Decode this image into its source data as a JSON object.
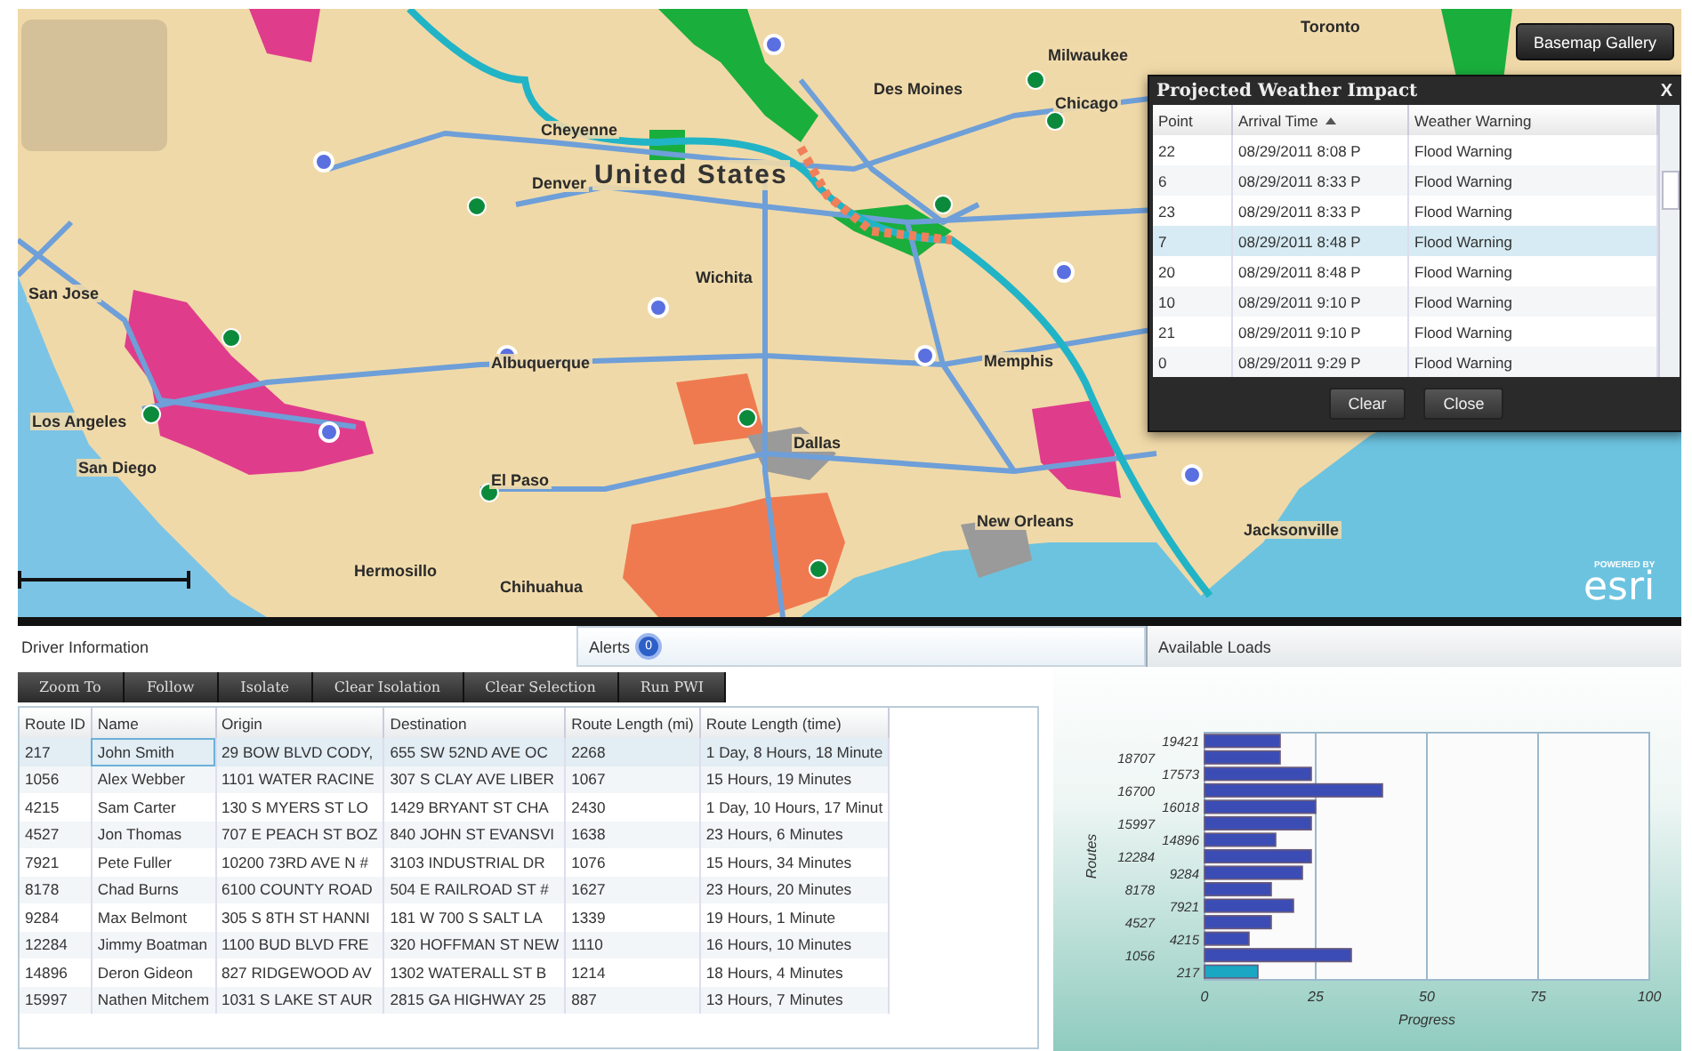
{
  "map": {
    "labels": [
      {
        "text": "Toronto",
        "kind": "city"
      },
      {
        "text": "Milwaukee",
        "kind": "city"
      },
      {
        "text": "Des Moines",
        "kind": "city"
      },
      {
        "text": "Chicago",
        "kind": "city"
      },
      {
        "text": "Cheyenne",
        "kind": "city"
      },
      {
        "text": "United States",
        "kind": "country"
      },
      {
        "text": "Denver",
        "kind": "city"
      },
      {
        "text": "Wichita",
        "kind": "city"
      },
      {
        "text": "San Jose",
        "kind": "city"
      },
      {
        "text": "Albuquerque",
        "kind": "city"
      },
      {
        "text": "Memphis",
        "kind": "city"
      },
      {
        "text": "Los Angeles",
        "kind": "city"
      },
      {
        "text": "San Diego",
        "kind": "city"
      },
      {
        "text": "El Paso",
        "kind": "city"
      },
      {
        "text": "Dallas",
        "kind": "city"
      },
      {
        "text": "New Orleans",
        "kind": "city"
      },
      {
        "text": "Jacksonville",
        "kind": "city"
      },
      {
        "text": "Hermosillo",
        "kind": "city"
      },
      {
        "text": "Chihuahua",
        "kind": "city"
      }
    ],
    "basemap_button": "Basemap Gallery",
    "logo": {
      "tagline": "POWERED BY",
      "name": "esri"
    }
  },
  "weather_dialog": {
    "title": "Projected Weather Impact",
    "close": "X",
    "columns": [
      {
        "label": "Point",
        "sorted": false
      },
      {
        "label": "Arrival Time",
        "sorted": true
      },
      {
        "label": "Weather Warning",
        "sorted": false
      }
    ],
    "rows": [
      {
        "point": "22",
        "arrival_time": "08/29/2011 8:08 P",
        "warning": "Flood Warning",
        "selected": false
      },
      {
        "point": "6",
        "arrival_time": "08/29/2011 8:33 P",
        "warning": "Flood Warning",
        "selected": false
      },
      {
        "point": "23",
        "arrival_time": "08/29/2011 8:33 P",
        "warning": "Flood Warning",
        "selected": false
      },
      {
        "point": "7",
        "arrival_time": "08/29/2011 8:48 P",
        "warning": "Flood Warning",
        "selected": true
      },
      {
        "point": "20",
        "arrival_time": "08/29/2011 8:48 P",
        "warning": "Flood Warning",
        "selected": false
      },
      {
        "point": "10",
        "arrival_time": "08/29/2011 9:10 P",
        "warning": "Flood Warning",
        "selected": false
      },
      {
        "point": "21",
        "arrival_time": "08/29/2011 9:10 P",
        "warning": "Flood Warning",
        "selected": false
      },
      {
        "point": "0",
        "arrival_time": "08/29/2011 9:29 P",
        "warning": "Flood Warning",
        "selected": false
      }
    ],
    "buttons": [
      "Clear",
      "Close"
    ]
  },
  "panels": [
    {
      "label": "Driver Information"
    },
    {
      "label": "Alerts",
      "count": "0"
    },
    {
      "label": "Available Loads"
    }
  ],
  "toolbar": [
    "Zoom To",
    "Follow",
    "Isolate",
    "Clear Isolation",
    "Clear Selection",
    "Run PWI"
  ],
  "table": {
    "columns": [
      "Route ID",
      "Name",
      "Origin",
      "Destination",
      "Route Length (mi)",
      "Route Length (time)"
    ],
    "rows": [
      {
        "cells": [
          "217",
          "John Smith",
          "29 BOW BLVD CODY,",
          "655 SW 52ND AVE OC",
          "2268",
          "1 Day, 8 Hours, 18 Minute"
        ],
        "selected": true
      },
      {
        "cells": [
          "1056",
          "Alex Webber",
          "1101 WATER RACINE",
          "307 S CLAY AVE LIBER",
          "1067",
          "15 Hours, 19 Minutes"
        ],
        "selected": false
      },
      {
        "cells": [
          "4215",
          "Sam Carter",
          "130 S MYERS ST LO",
          "1429 BRYANT ST CHA",
          "2430",
          "1 Day, 10 Hours, 17 Minut"
        ],
        "selected": false
      },
      {
        "cells": [
          "4527",
          "Jon Thomas",
          "707 E PEACH ST BOZ",
          "840 JOHN ST EVANSVI",
          "1638",
          "23 Hours, 6 Minutes"
        ],
        "selected": false
      },
      {
        "cells": [
          "7921",
          "Pete Fuller",
          "10200 73RD AVE N #",
          "3103 INDUSTRIAL DR",
          "1076",
          "15 Hours, 34 Minutes"
        ],
        "selected": false
      },
      {
        "cells": [
          "8178",
          "Chad Burns",
          "6100 COUNTY ROAD",
          "504 E RAILROAD ST #",
          "1627",
          "23 Hours, 20 Minutes"
        ],
        "selected": false
      },
      {
        "cells": [
          "9284",
          "Max Belmont",
          "305 S 8TH ST HANNI",
          "181 W 700 S SALT LA",
          "1339",
          "19 Hours, 1 Minute"
        ],
        "selected": false
      },
      {
        "cells": [
          "12284",
          "Jimmy Boatman",
          "1100 BUD BLVD FRE",
          "320 HOFFMAN ST NEW",
          "1110",
          "16 Hours, 10 Minutes"
        ],
        "selected": false
      },
      {
        "cells": [
          "14896",
          "Deron Gideon",
          "827 RIDGEWOOD AV",
          "1302 WATERALL ST B",
          "1214",
          "18 Hours, 4 Minutes"
        ],
        "selected": false
      },
      {
        "cells": [
          "15997",
          "Nathen Mitchem",
          "1031 S LAKE ST AUR",
          "2815 GA HIGHWAY 25",
          "887",
          "13 Hours, 7 Minutes"
        ],
        "selected": false
      }
    ]
  },
  "chart_data": {
    "type": "bar",
    "orientation": "horizontal",
    "xlabel": "Progress",
    "ylabel": "Routes",
    "categories": [
      "19421",
      "18707",
      "17573",
      "16700",
      "16018",
      "15997",
      "14896",
      "12284",
      "9284",
      "8178",
      "7921",
      "4527",
      "4215",
      "1056",
      "217"
    ],
    "series": [
      {
        "color": "#3b4db5",
        "values": [
          17,
          17,
          24,
          40,
          25,
          24,
          16,
          24,
          22,
          15,
          20,
          15,
          10,
          33,
          null
        ]
      },
      {
        "color": "#19a7c4",
        "values": [
          null,
          null,
          null,
          null,
          null,
          null,
          null,
          null,
          null,
          null,
          null,
          null,
          null,
          null,
          12
        ]
      }
    ],
    "grid": true,
    "xlim": [
      0,
      100
    ],
    "xticks": [
      0,
      25,
      50,
      75,
      100
    ]
  }
}
